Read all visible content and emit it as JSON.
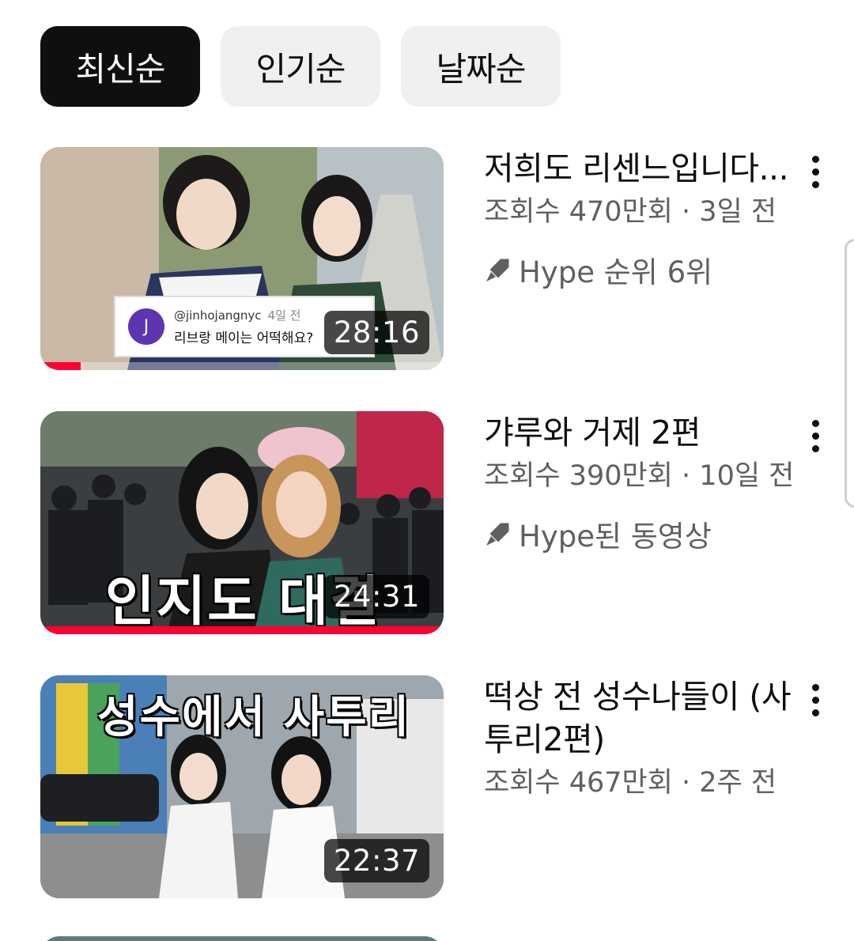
{
  "filters": [
    {
      "label": "최신순",
      "active": true
    },
    {
      "label": "인기순",
      "active": false
    },
    {
      "label": "날짜순",
      "active": false
    }
  ],
  "videos": [
    {
      "title": "저희도 리센느입니다...",
      "stats": "조회수 470만회 · 3일 전",
      "hype": "Hype 순위 6위",
      "duration": "28:16",
      "watched_fraction": 0.1,
      "comment": {
        "avatar": "J",
        "handle": "@jinhojangnyc",
        "time": "4일 전",
        "text": "리브랑 메이는 어떡해요?"
      }
    },
    {
      "title": "갸루와 거제 2편",
      "stats": "조회수 390만회 · 10일 전",
      "hype": "Hype된 동영상",
      "duration": "24:31",
      "watched_fraction": 1.0,
      "thumb_text": "인지도 대결"
    },
    {
      "title": "떡상 전 성수나들이 (사투리2편)",
      "stats": "조회수 467만회 · 2주 전",
      "duration": "22:37",
      "thumb_text": "성수에서 사투리"
    }
  ],
  "icons": {
    "hype": "hype-rocket-icon",
    "more": "more-vert-icon"
  },
  "colors": {
    "accent": "#ff0033",
    "chip_active": "#0f0f0f",
    "chip_inactive": "#f0f0f0",
    "secondary_text": "#606060"
  }
}
